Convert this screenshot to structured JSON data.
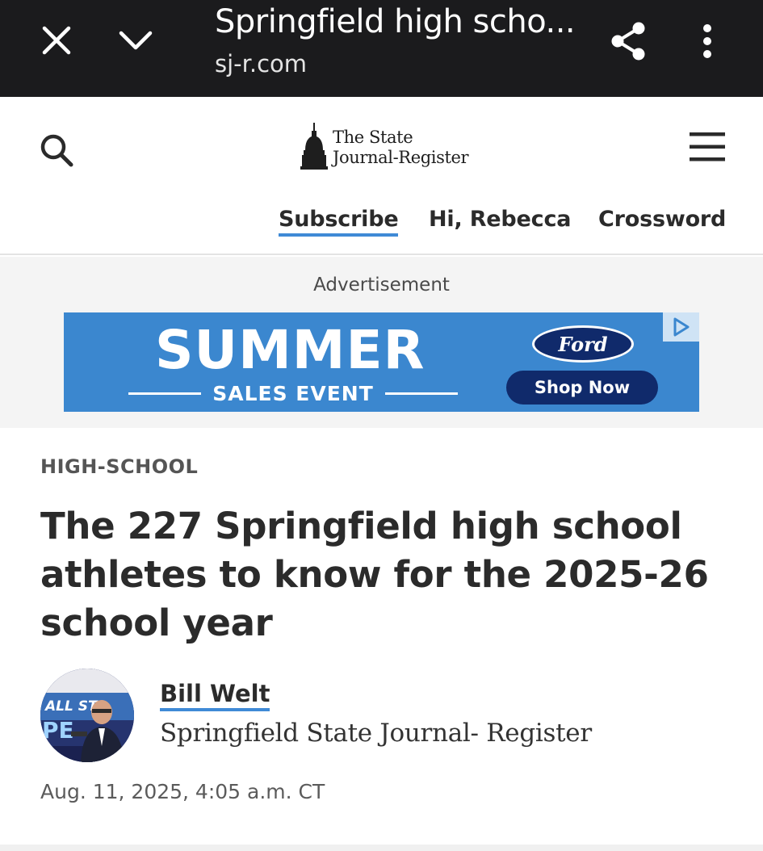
{
  "browser": {
    "title": "Springfield high scho...",
    "url": "sj-r.com",
    "icons": {
      "close": "close-icon",
      "collapse": "chevron-down-icon",
      "share": "share-icon",
      "more": "more-vertical-icon"
    }
  },
  "site": {
    "logo_line1": "The State",
    "logo_line2": "Journal-Register",
    "nav": {
      "subscribe": "Subscribe",
      "greeting": "Hi, Rebecca",
      "crossword": "Crossword"
    },
    "icons": {
      "search": "search-icon",
      "menu": "hamburger-menu-icon"
    }
  },
  "ad": {
    "label": "Advertisement",
    "headline": "SUMMER",
    "subline": "SALES EVENT",
    "brand": "Ford",
    "cta": "Shop Now",
    "background_color": "#3b87cf",
    "button_color": "#102a6b"
  },
  "article": {
    "kicker": "HIGH-SCHOOL",
    "headline": "The 227 Springfield high school athletes to know for the 2025-26 school year",
    "author": "Bill Welt",
    "organization": "Springfield State Journal- Register",
    "date": "Aug. 11, 2025, 4:05 a.m. CT"
  },
  "colors": {
    "browser_bar": "#1b1b1d",
    "accent_underline": "#3f8ad6",
    "text": "#2b2b2b"
  }
}
